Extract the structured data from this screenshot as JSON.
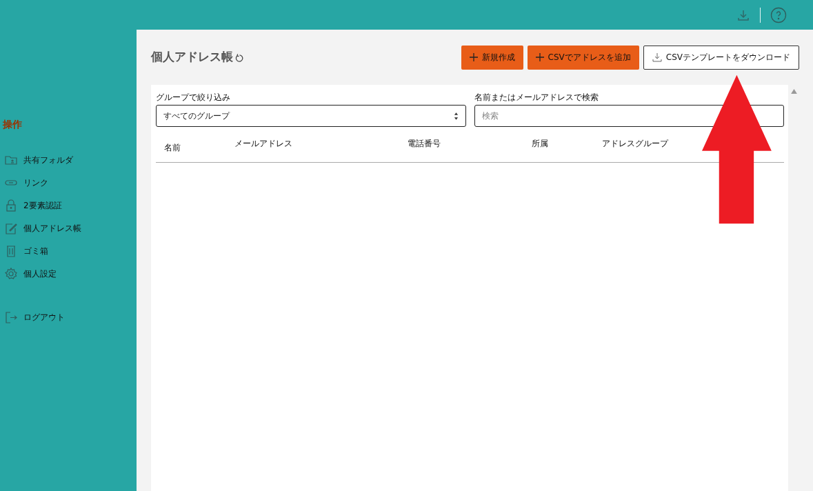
{
  "sidebar": {
    "title": "操作",
    "items": [
      {
        "kind": "folder",
        "label": "共有フォルダ"
      },
      {
        "kind": "link",
        "label": "リンク"
      },
      {
        "kind": "lock",
        "label": "2要素認証"
      },
      {
        "kind": "edit",
        "label": "個人アドレス帳"
      },
      {
        "kind": "trash",
        "label": "ゴミ箱"
      },
      {
        "kind": "gear",
        "label": "個人設定"
      },
      {
        "kind": "logout",
        "label": "ログアウト"
      }
    ]
  },
  "page": {
    "title": "個人アドレス帳",
    "buttons": [
      {
        "kind": "add",
        "label": "新規作成"
      },
      {
        "kind": "add",
        "label": "CSVでアドレスを追加"
      },
      {
        "kind": "download",
        "label": "CSVテンプレートをダウンロード"
      }
    ]
  },
  "filter": {
    "label": "グループで絞り込み",
    "value": "すべてのグループ"
  },
  "search": {
    "label": "名前またはメールアドレスで検索",
    "placeholder": "検索"
  },
  "table": {
    "columns": [
      "名前",
      "メールアドレス",
      "電話番号",
      "所属",
      "アドレスグループ"
    ]
  }
}
